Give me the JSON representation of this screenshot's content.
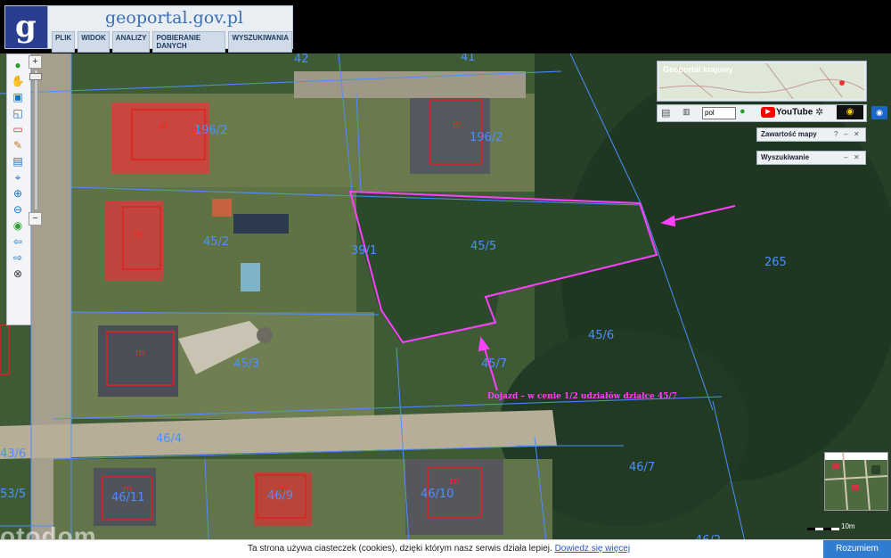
{
  "header": {
    "brand": "geoportal.gov.pl",
    "logo_letter": "g",
    "menu": [
      "PLIK",
      "WIDOK",
      "ANALIZY",
      "POBIERANIE DANYCH",
      "WYSZUKIWANIA"
    ]
  },
  "overview": {
    "title": "Geoportal krajowy"
  },
  "panel_toolbar": {
    "language": "pol",
    "youtube": "YouTube"
  },
  "panels": {
    "map_contents": "Zawartość mapy",
    "search": "Wyszukiwanie"
  },
  "parcels": {
    "p1": "196/2",
    "p2": "196/2",
    "p3": "45/2",
    "p4": "39/1",
    "p5": "45/5",
    "p6": "265",
    "p7": "45/6",
    "p8": "45/3",
    "p9": "45/7",
    "p10": "46/4",
    "p11": "46/7",
    "p12": "46/11",
    "p13": "46/9",
    "p14": "46/10",
    "p15": "43/6",
    "p16": "53/5",
    "p17": "42",
    "p18": "41",
    "p19": "46/2"
  },
  "building_marker": "m",
  "annotation": "Dojazd – w cenie 1/2 udziałów działce 45/7",
  "scale_text": "10m",
  "watermark": "otodom",
  "cookie": {
    "text": "Ta strona używa ciasteczek (cookies), dzięki którym nasz serwis działa lepiej.",
    "link": "Dowiedz się więcej",
    "button": "Rozumiem"
  },
  "colors": {
    "plot_outline": "#ff40ff",
    "parcel_lines": "#4a90ff",
    "buildings": "#e02020",
    "header_bg": "#e9eef3",
    "cookie_button": "#2f7cd1"
  }
}
